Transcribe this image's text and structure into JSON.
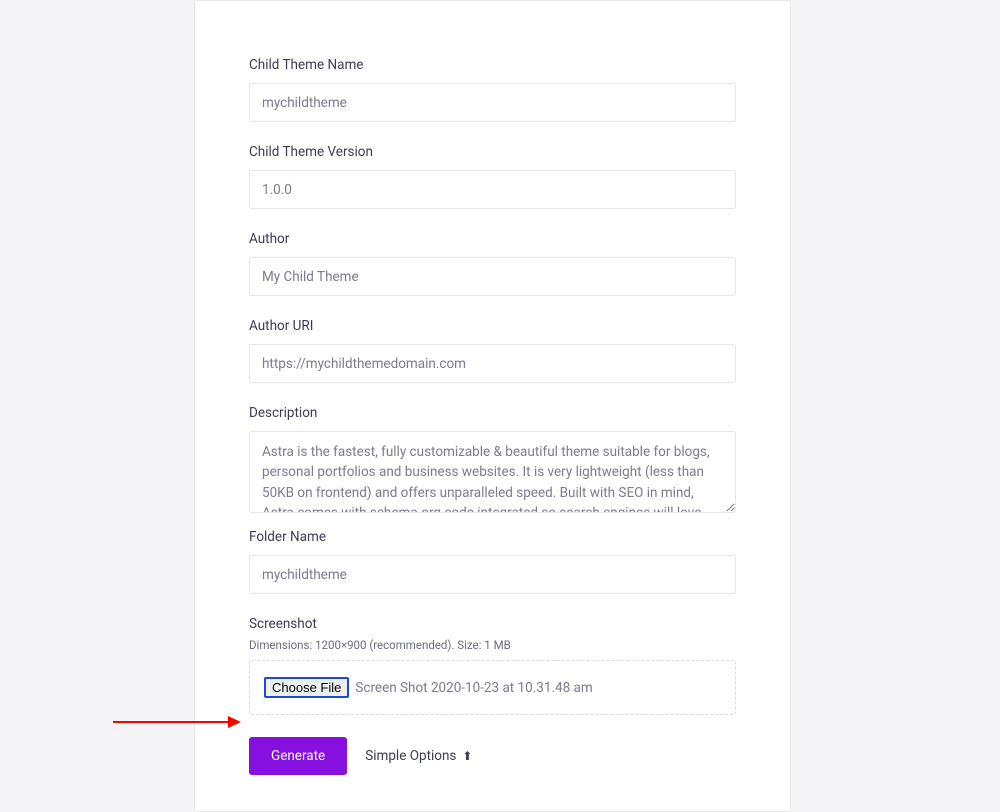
{
  "form": {
    "childThemeName": {
      "label": "Child Theme Name",
      "value": "mychildtheme"
    },
    "childThemeVersion": {
      "label": "Child Theme Version",
      "value": "1.0.0"
    },
    "author": {
      "label": "Author",
      "value": "My Child Theme"
    },
    "authorUri": {
      "label": "Author URI",
      "value": "https://mychildthemedomain.com"
    },
    "description": {
      "label": "Description",
      "value": "Astra is the fastest, fully customizable & beautiful theme suitable for blogs, personal portfolios and business websites. It is very lightweight (less than 50KB on frontend) and offers unparalleled speed. Built with SEO in mind, Astra comes with schema.org code integrated so search engines will love your site. Astra offers"
    },
    "folderName": {
      "label": "Folder Name",
      "value": "mychildtheme"
    },
    "screenshot": {
      "label": "Screenshot",
      "hint": "Dimensions: 1200×900 (recommended). Size: 1 MB",
      "chooseFile": "Choose File",
      "fileName": "Screen Shot 2020-10-23 at 10.31.48 am"
    }
  },
  "actions": {
    "generate": "Generate",
    "simpleOptions": "Simple Options"
  }
}
